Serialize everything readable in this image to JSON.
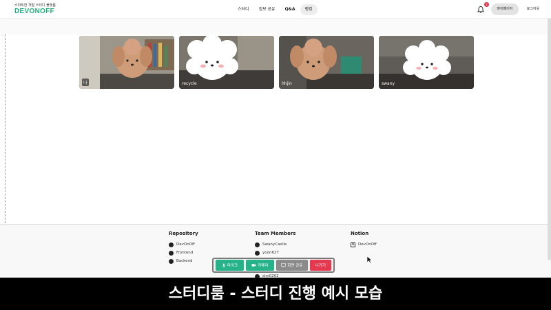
{
  "header": {
    "logo_tagline": "스마트한 개발 스터디 플랫폼",
    "logo_text": "DEVONOFF",
    "nav": [
      "스터디",
      "정보 공유",
      "Q&A",
      "랭킹"
    ],
    "notification_count": "2",
    "mypage_label": "마이페이지",
    "logout_label": "로그아웃"
  },
  "participants": [
    {
      "name": "나",
      "avatar": "brown-dog-icon"
    },
    {
      "name": "recycle",
      "avatar": "white-dog-icon"
    },
    {
      "name": "hhjin",
      "avatar": "brown-dog-icon"
    },
    {
      "name": "swany",
      "avatar": "white-dog-icon"
    }
  ],
  "controls": {
    "mic_label": "마이크",
    "camera_label": "카메라",
    "share_label": "화면 공유",
    "leave_label": "나가기"
  },
  "footer": {
    "repository_title": "Repository",
    "repository_links": [
      "DevOnOff",
      "Frontend",
      "Backend"
    ],
    "team_title": "Team Members",
    "team_links": [
      "SwanyCastle",
      "yoon627",
      "sim0202"
    ],
    "notion_title": "Notion",
    "notion_links": [
      "DevOnOff"
    ]
  },
  "caption": "스터디룸 - 스터디 진행 예시 모습",
  "colors": {
    "brand": "#22b07d",
    "mic": "#27b38a",
    "share": "#8b8b8b",
    "leave": "#e53950",
    "badge": "#e0364c"
  }
}
